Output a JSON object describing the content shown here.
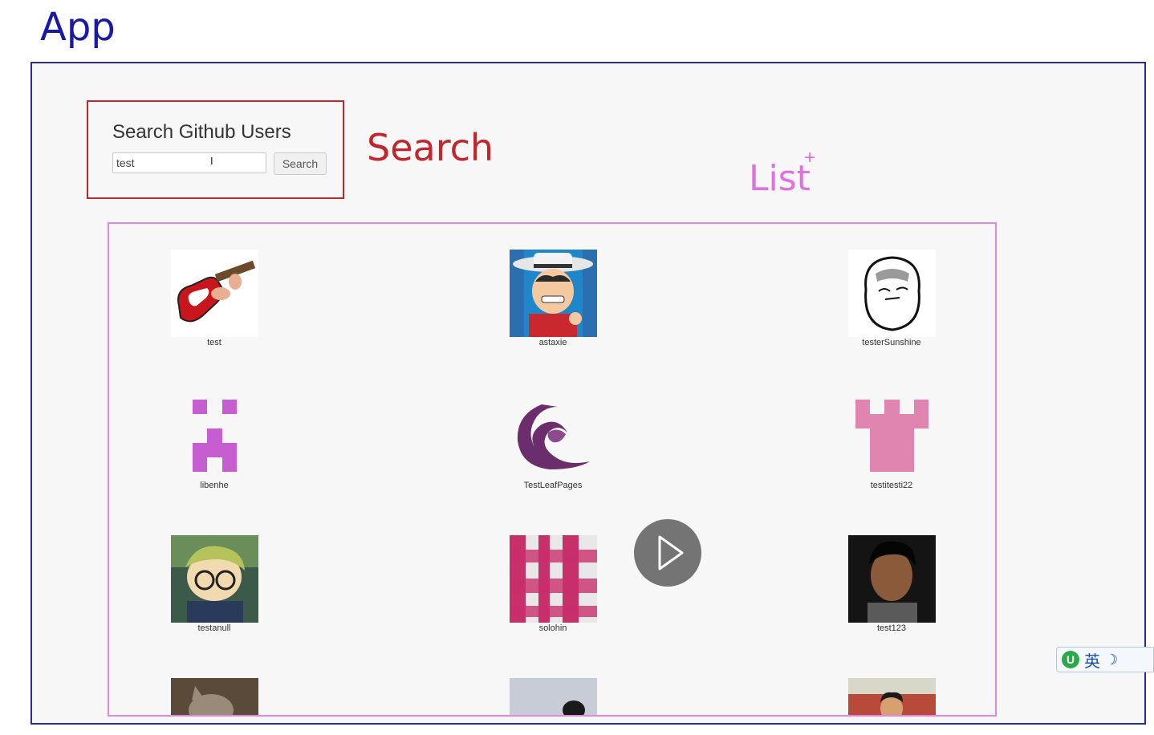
{
  "annotations": {
    "app": "App",
    "search": "Search",
    "list": "List",
    "list_mark": "+"
  },
  "search": {
    "title": "Search Github Users",
    "input_value": "test",
    "cursor": "I",
    "button_label": "Search"
  },
  "users": [
    {
      "login": "test",
      "avatar": "guitar-avatar"
    },
    {
      "login": "astaxie",
      "avatar": "cowboy-cartoon-avatar"
    },
    {
      "login": "testerSunshine",
      "avatar": "meme-face-avatar"
    },
    {
      "login": "libenhe",
      "avatar": "pixel-identicon-purple"
    },
    {
      "login": "TestLeafPages",
      "avatar": "swirl-logo-avatar"
    },
    {
      "login": "testitesti22",
      "avatar": "pixel-identicon-pink"
    },
    {
      "login": "testanull",
      "avatar": "anime-glasses-avatar"
    },
    {
      "login": "solohin",
      "avatar": "plaid-fabric-avatar"
    },
    {
      "login": "test123",
      "avatar": "person-photo-avatar"
    },
    {
      "login": "",
      "avatar": "cat-photo-avatar"
    },
    {
      "login": "",
      "avatar": "partial-photo-avatar"
    },
    {
      "login": "",
      "avatar": "person-photo-avatar"
    }
  ],
  "player": {
    "icon": "play-icon"
  },
  "ime": {
    "logo": "U",
    "language": "英",
    "mode": "☽"
  },
  "colors": {
    "app_border": "#2a2a9a",
    "search_annotation": "#c0262c",
    "list_annotation": "#e070e0",
    "identicon_purple": "#c65ed1",
    "identicon_pink": "#e084b0"
  }
}
